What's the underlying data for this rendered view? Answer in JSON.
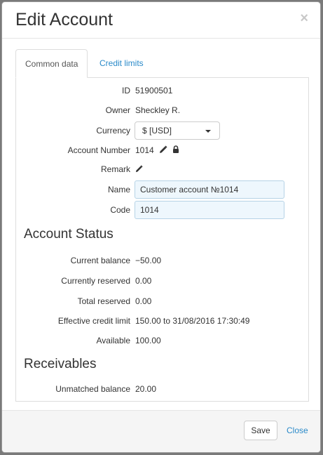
{
  "modal": {
    "title": "Edit Account",
    "close_glyph": "×"
  },
  "tabs": [
    {
      "label": "Common data",
      "active": true
    },
    {
      "label": "Credit limits",
      "active": false
    }
  ],
  "common": {
    "id_label": "ID",
    "id_value": "51900501",
    "owner_label": "Owner",
    "owner_value": "Sheckley R.",
    "currency_label": "Currency",
    "currency_value": "$ [USD]",
    "account_number_label": "Account Number",
    "account_number_value": "1014",
    "account_number_icons": [
      "pencil-icon",
      "lock-icon"
    ],
    "remark_label": "Remark",
    "remark_icon": "pencil-icon",
    "name_label": "Name",
    "name_value": "Customer account №1014",
    "code_label": "Code",
    "code_value": "1014"
  },
  "account_status": {
    "heading": "Account Status",
    "current_balance_label": "Current balance",
    "current_balance_value": "−50.00",
    "currently_reserved_label": "Currently reserved",
    "currently_reserved_value": "0.00",
    "total_reserved_label": "Total reserved",
    "total_reserved_value": "0.00",
    "effective_credit_limit_label": "Effective credit limit",
    "effective_credit_limit_value": "150.00 to 31/08/2016 17:30:49",
    "available_label": "Available",
    "available_value": "100.00"
  },
  "receivables": {
    "heading": "Receivables",
    "unmatched_balance_label": "Unmatched balance",
    "unmatched_balance_value": "20.00"
  },
  "footer": {
    "save_label": "Save",
    "close_label": "Close"
  },
  "colors": {
    "accent_link": "#2a8ac9",
    "input_bg": "#eef7fd",
    "input_border": "#b6d3e6"
  }
}
